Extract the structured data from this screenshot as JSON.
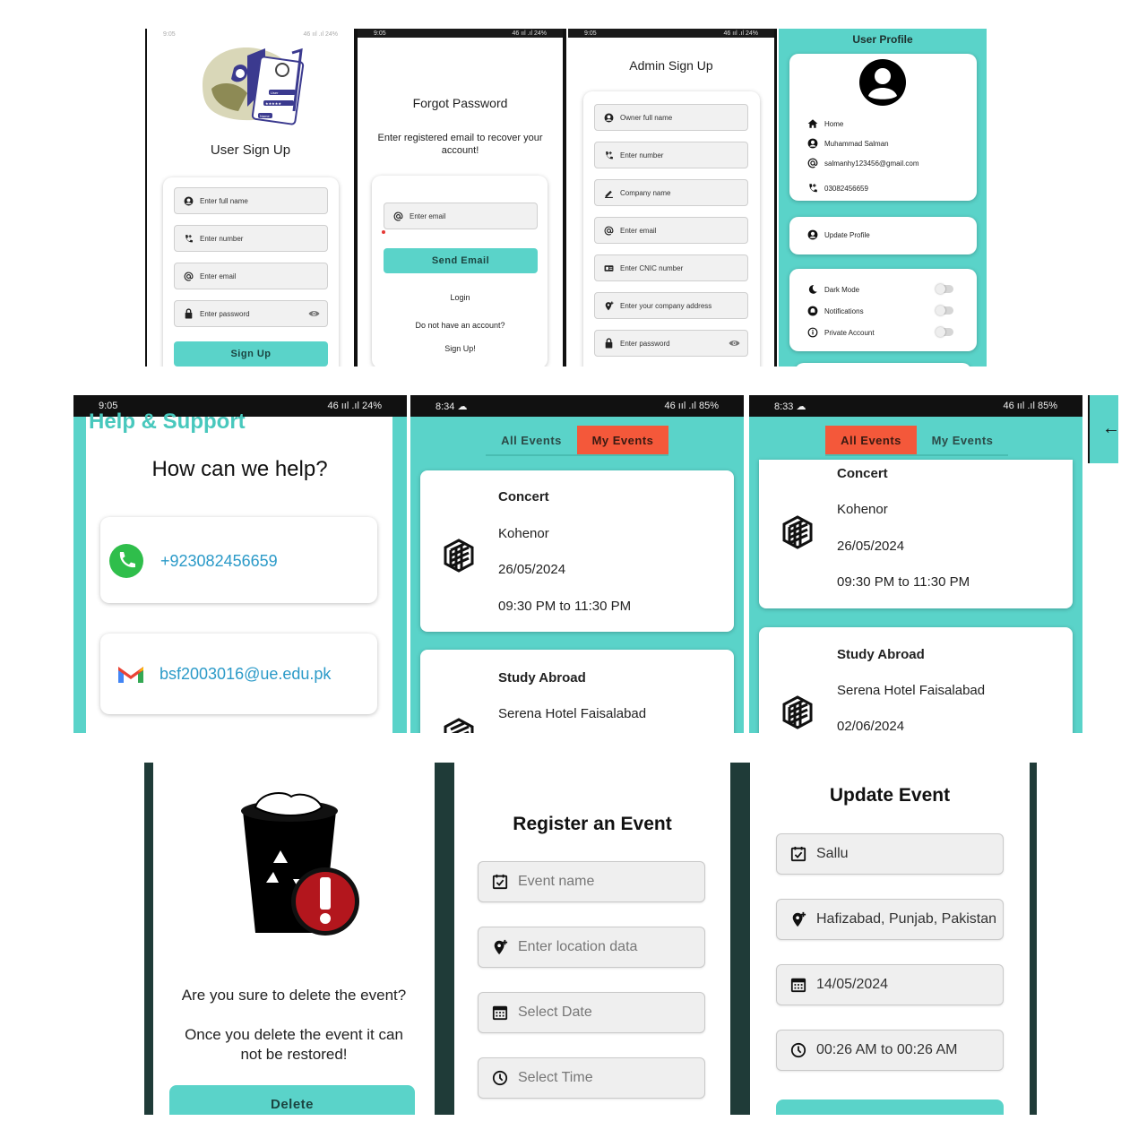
{
  "screens": {
    "user_signup": {
      "status_time": "9:05",
      "status_right": "46 ııl .ıl 24%",
      "title": "User Sign Up",
      "fields": [
        "Enter full name",
        "Enter number",
        "Enter email",
        "Enter password"
      ],
      "button": "Sign Up",
      "illustration_texts": [
        "User",
        "★★★★★",
        "Name"
      ]
    },
    "forgot_password": {
      "status_time": "9:05",
      "status_right": "46 ııl .ıl 24%",
      "title": "Forgot Password",
      "subtitle": "Enter registered email to recover your account!",
      "field": "Enter email",
      "button": "Send Email",
      "login": "Login",
      "no_account": "Do not have an account?",
      "signup": "Sign Up!"
    },
    "admin_signup": {
      "status_time": "9:05",
      "status_right": "46 ııl .ıl 24%",
      "title": "Admin Sign Up",
      "fields": [
        "Owner full name",
        "Enter number",
        "Company name",
        "Enter email",
        "Enter CNIC number",
        "Enter your company address",
        "Enter password"
      ]
    },
    "user_profile": {
      "title": "User Profile",
      "items": [
        "Home",
        "Muhammad Salman",
        "salmanhy123456@gmail.com",
        "03082456659"
      ],
      "update": "Update Profile",
      "settings": [
        "Dark Mode",
        "Notifications",
        "Private Account"
      ]
    },
    "help_support": {
      "status_time": "9:05",
      "status_right": "46 ııl .ıl 24%",
      "header": "Help & Support",
      "question": "How can we help?",
      "phone": "+923082456659",
      "email": "bsf2003016@ue.edu.pk"
    },
    "my_events": {
      "status_time": "8:34",
      "status_right": "46 ııl .ıl 85%",
      "tabs": [
        "All Events",
        "My Events"
      ],
      "events": [
        {
          "title": "Concert",
          "location": "Kohenor",
          "date": "26/05/2024",
          "time": "09:30 PM to 11:30 PM"
        },
        {
          "title": "Study Abroad",
          "location": "Serena Hotel Faisalabad"
        }
      ]
    },
    "all_events": {
      "status_time": "8:33",
      "status_right": "46 ııl .ıl 85%",
      "tabs": [
        "All Events",
        "My Events"
      ],
      "events": [
        {
          "title": "Concert",
          "location": "Kohenor",
          "date": "26/05/2024",
          "time": "09:30 PM to 11:30 PM"
        },
        {
          "title": "Study Abroad",
          "location": "Serena Hotel Faisalabad",
          "date": "02/06/2024"
        }
      ]
    },
    "delete_event": {
      "question": "Are you sure to delete the event?",
      "warning": "Once you delete the event it can not be restored!",
      "button": "Delete"
    },
    "register_event": {
      "title": "Register an Event",
      "fields": [
        "Event name",
        "Enter location data",
        "Select Date",
        "Select Time"
      ]
    },
    "update_event": {
      "title": "Update Event",
      "fields": [
        "Sallu",
        "Hafizabad, Punjab, Pakistan",
        "14/05/2024",
        "00:26 AM to 00:26 AM"
      ]
    }
  },
  "colors": {
    "teal": "#5ad3c9",
    "tab_active": "#f4583a",
    "whatsapp": "#2fbe4b",
    "dark_border": "#1f3b38"
  }
}
